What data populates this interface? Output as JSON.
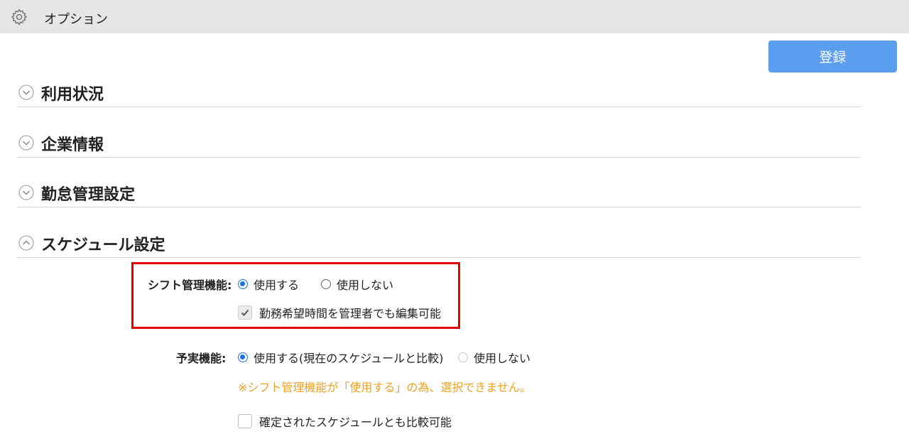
{
  "header": {
    "title": "オプション",
    "icon": "gear-icon"
  },
  "toolbar": {
    "register_label": "登録"
  },
  "sections": [
    {
      "label": "利用状況",
      "expanded": false
    },
    {
      "label": "企業情報",
      "expanded": false
    },
    {
      "label": "勤怠管理設定",
      "expanded": false
    },
    {
      "label": "スケジュール設定",
      "expanded": true
    }
  ],
  "schedule": {
    "shift": {
      "label": "シフト管理機能:",
      "options": [
        {
          "label": "使用する",
          "selected": true
        },
        {
          "label": "使用しない",
          "selected": false
        }
      ],
      "checkbox": {
        "label": "勤務希望時間を管理者でも編集可能",
        "checked": true
      }
    },
    "forecast": {
      "label": "予実機能:",
      "options": [
        {
          "label": "使用する(現在のスケジュールと比較)",
          "selected": true
        },
        {
          "label": "使用しない",
          "selected": false,
          "disabled": true
        }
      ],
      "note": "※シフト管理機能が「使用する」の為、選択できません。",
      "checkbox": {
        "label": "確定されたスケジュールとも比較可能",
        "checked": false
      }
    }
  },
  "colors": {
    "accent": "#5b9def",
    "highlight": "#e00000",
    "note": "#f0a020",
    "radio": "#1a73e8"
  }
}
